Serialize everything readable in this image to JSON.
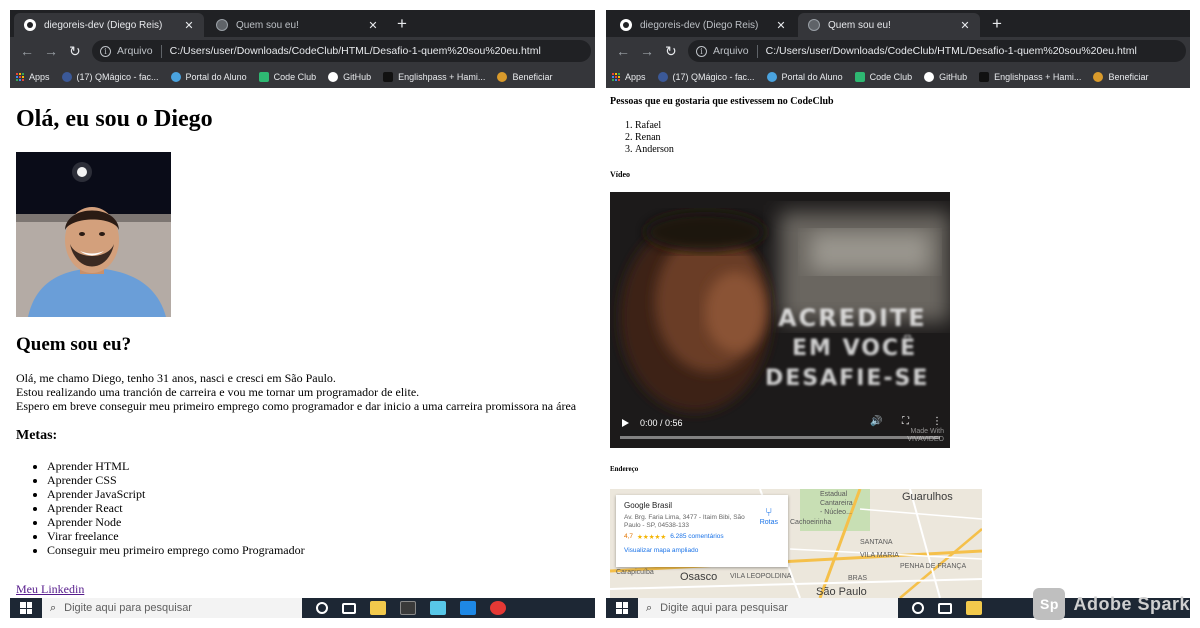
{
  "colors": {
    "chrome_dark": "#202124",
    "chrome_tab": "#35363a",
    "link_visited": "#551a8b",
    "taskbar": "#1d2734"
  },
  "left_window": {
    "tabs": [
      {
        "title": "diegoreis-dev (Diego Reis)",
        "icon": "github-icon",
        "active": true
      },
      {
        "title": "Quem sou eu!",
        "icon": "globe-icon",
        "active": false
      }
    ],
    "address": {
      "label": "Arquivo",
      "url": "C:/Users/user/Downloads/CodeClub/HTML/Desafio-1-quem%20sou%20eu.html"
    },
    "bookmarks": [
      "Apps",
      "(17) QMágico - fac...",
      "Portal do Aluno",
      "Code Club",
      "GitHub",
      "Englishpass + Hami...",
      "Beneficiar"
    ],
    "page": {
      "heading": "Olá, eu sou o Diego",
      "about_heading": "Quem sou eu?",
      "about_lines": [
        "Olá, me chamo Diego, tenho 31 anos, nasci e cresci em São Paulo.",
        "Estou realizando uma tranción de carreira e vou me tornar um programador de elite.",
        "Espero em breve conseguir meu primeiro emprego como programador e dar inicio a uma carreira promissora na área"
      ],
      "goals_heading": "Metas:",
      "goals": [
        "Aprender HTML",
        "Aprender CSS",
        "Aprender JavaScript",
        "Aprender React",
        "Aprender Node",
        "Virar freelance",
        "Conseguir meu primeiro emprego como Programador"
      ],
      "link": "Meu Linkedin"
    },
    "taskbar": {
      "search_placeholder": "Digite aqui para pesquisar"
    }
  },
  "right_window": {
    "tabs": [
      {
        "title": "diegoreis-dev (Diego Reis)",
        "icon": "github-icon",
        "active": false
      },
      {
        "title": "Quem sou eu!",
        "icon": "globe-icon",
        "active": true
      }
    ],
    "address": {
      "label": "Arquivo",
      "url": "C:/Users/user/Downloads/CodeClub/HTML/Desafio-1-quem%20sou%20eu.html"
    },
    "bookmarks": [
      "Apps",
      "(17) QMágico - fac...",
      "Portal do Aluno",
      "Code Club",
      "GitHub",
      "Englishpass + Hami...",
      "Beneficiar"
    ],
    "page": {
      "people_heading": "Pessoas que eu gostaria que estivessem no CodeClub",
      "people": [
        "Rafael",
        "Renan",
        "Anderson"
      ],
      "video_heading": "Vídeo",
      "video": {
        "overlay_lines": [
          "ACREDITE",
          "EM VOCÊ",
          "DESAFIE-SE"
        ],
        "time": "0:00 / 0:56",
        "watermark_lines": [
          "Made With",
          "VIVAVIDEO"
        ],
        "progress": 0
      },
      "address_heading": "Endereço",
      "map": {
        "place_name": "Google Brasil",
        "place_address": "Av. Brg. Faria Lima, 3477 - Itaim Bibi, São Paulo - SP, 04538-133",
        "rating": "4,7",
        "reviews": "6.285 comentários",
        "directions": "Rotas",
        "view_larger": "Visualizar mapa ampliado",
        "labels": [
          "Estadual",
          "Cantareira",
          "- Núcleo...",
          "Cachoeirinha",
          "SANTANA",
          "VILA MARIA",
          "VILA LEOPOLDINA",
          "BRAS",
          "PENHA DE FRANÇA",
          "Carapicuíba"
        ],
        "cities": [
          "Guarulhos",
          "Osasco",
          "São Paulo"
        ]
      }
    },
    "taskbar": {
      "search_placeholder": "Digite aqui para pesquisar"
    }
  },
  "badge": {
    "logo": "Sp",
    "text": "Adobe Spark"
  }
}
